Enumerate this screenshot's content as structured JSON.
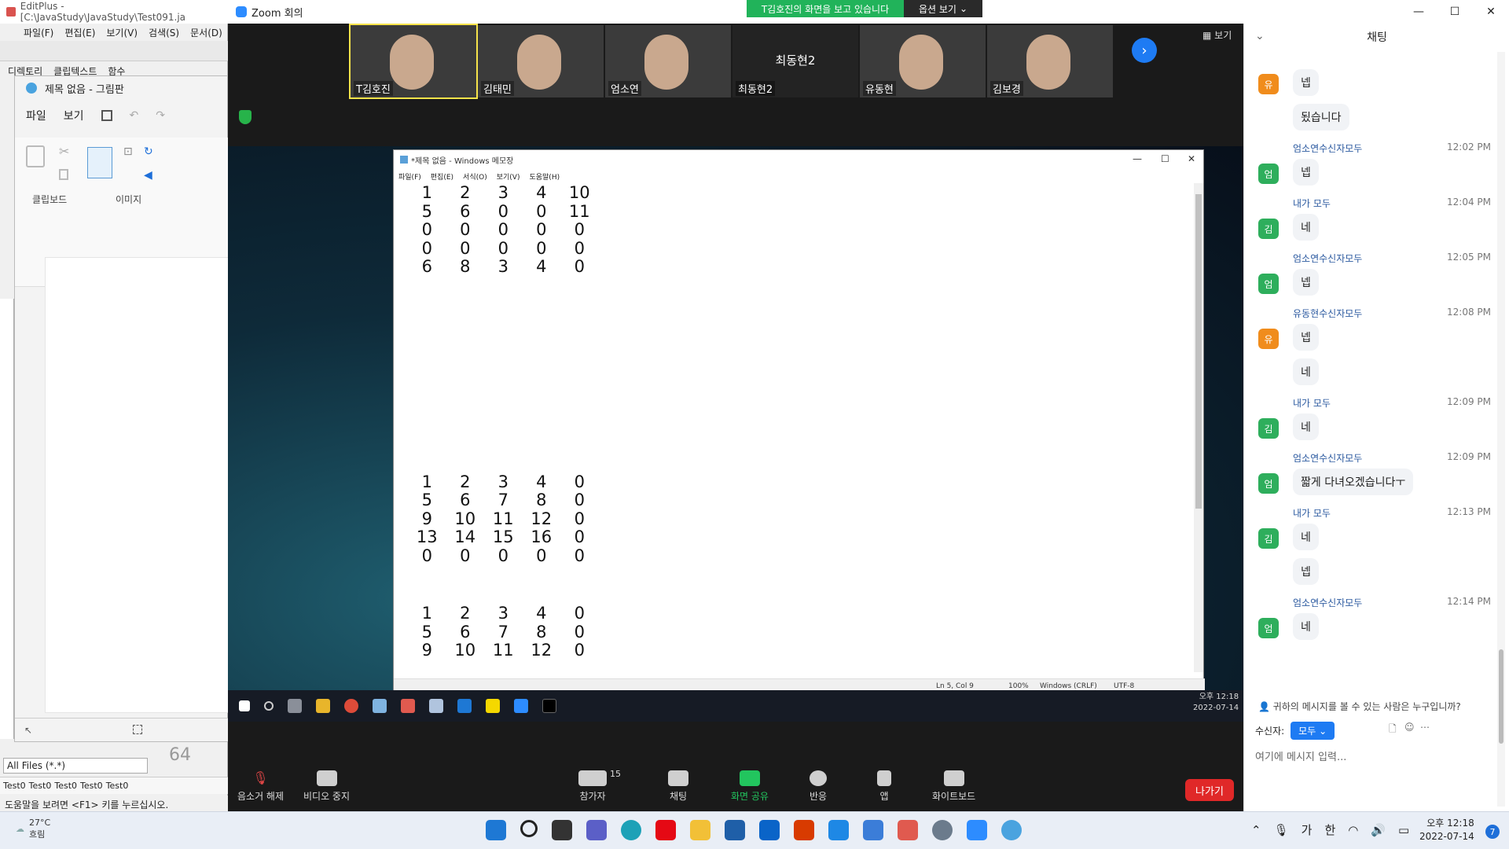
{
  "editplus": {
    "title": "EditPlus - [C:\\JavaStudy\\JavaStudy\\Test091.ja",
    "menu": [
      "파일(F)",
      "편집(E)",
      "보기(V)",
      "검색(S)",
      "문서(D)"
    ],
    "tabs": [
      "디렉토리",
      "클립텍스트",
      "함수"
    ],
    "filter": "All Files (*.*)",
    "files": [
      "Test0",
      "Test0",
      "Test0",
      "Test0",
      "Test0"
    ],
    "status": "도움말을 보려면 <F1> 키를 누르십시오.",
    "number": "64"
  },
  "paint": {
    "title": "제목 없음 - 그림판",
    "menu": [
      "파일",
      "보기"
    ],
    "groups": [
      "클립보드",
      "이미지"
    ]
  },
  "zoom": {
    "title": "Zoom 회의",
    "banner": "T김호진의 화면을 보고 있습니다",
    "view_options": "옵션 보기",
    "view_button": "보기",
    "participants": [
      {
        "name": "T김호진",
        "video": true,
        "active": true
      },
      {
        "name": "김태민",
        "video": true
      },
      {
        "name": "엄소연",
        "video": true
      },
      {
        "name": "최동현2",
        "video": false,
        "big": "최동현2"
      },
      {
        "name": "유동현",
        "video": true
      },
      {
        "name": "김보경",
        "video": true
      }
    ],
    "toolbar": {
      "mute": "음소거 해제",
      "video": "비디오 중지",
      "participants": "참가자",
      "participants_count": "15",
      "chat": "채팅",
      "share": "화면 공유",
      "reactions": "반응",
      "apps": "앱",
      "whiteboard": "화이트보드",
      "leave": "나가기"
    }
  },
  "notepad": {
    "title": "*제목 없음 - Windows 메모장",
    "menu": [
      "파일(F)",
      "편집(E)",
      "서식(O)",
      "보기(V)",
      "도움말(H)"
    ],
    "block1": [
      [
        "1",
        "2",
        "3",
        "4",
        "10"
      ],
      [
        "5",
        "6",
        "0",
        "0",
        "11"
      ],
      [
        "0",
        "0",
        "0",
        "0",
        "0"
      ],
      [
        "0",
        "0",
        "0",
        "0",
        "0"
      ],
      [
        "6",
        "8",
        "3",
        "4",
        "0"
      ]
    ],
    "block2": [
      [
        "1",
        "2",
        "3",
        "4",
        "0"
      ],
      [
        "5",
        "6",
        "7",
        "8",
        "0"
      ],
      [
        "9",
        "10",
        "11",
        "12",
        "0"
      ],
      [
        "13",
        "14",
        "15",
        "16",
        "0"
      ],
      [
        "0",
        "0",
        "0",
        "0",
        "0"
      ]
    ],
    "block3": [
      [
        "1",
        "2",
        "3",
        "4",
        "0"
      ],
      [
        "5",
        "6",
        "7",
        "8",
        "0"
      ],
      [
        "9",
        "10",
        "11",
        "12",
        "0"
      ]
    ],
    "status": {
      "position": "Ln 5, Col 9",
      "zoom": "100%",
      "eol": "Windows (CRLF)",
      "encoding": "UTF-8"
    }
  },
  "remote_clock": {
    "time": "오후 12:18",
    "date": "2022-07-14"
  },
  "chat": {
    "header": "채팅",
    "messages": [
      {
        "sender": "",
        "time": "",
        "avatar": "유",
        "color": "#f08c1c",
        "texts": [
          "넵",
          "됬습니다"
        ]
      },
      {
        "sender": "엄소연수신자모두",
        "time": "12:02 PM",
        "avatar": "엄",
        "color": "#2eae5c",
        "texts": [
          "넵"
        ]
      },
      {
        "sender": "내가 모두",
        "time": "12:04 PM",
        "avatar": "김",
        "color": "#2eae5c",
        "texts": [
          "네"
        ]
      },
      {
        "sender": "엄소연수신자모두",
        "time": "12:05 PM",
        "avatar": "엄",
        "color": "#2eae5c",
        "texts": [
          "넵"
        ]
      },
      {
        "sender": "유동현수신자모두",
        "time": "12:08 PM",
        "avatar": "유",
        "color": "#f08c1c",
        "texts": [
          "넵",
          "네"
        ]
      },
      {
        "sender": "내가 모두",
        "time": "12:09 PM",
        "avatar": "김",
        "color": "#2eae5c",
        "texts": [
          "네"
        ]
      },
      {
        "sender": "엄소연수신자모두",
        "time": "12:09 PM",
        "avatar": "엄",
        "color": "#2eae5c",
        "texts": [
          "짧게 다녀오겠습니다ㅜ"
        ]
      },
      {
        "sender": "내가 모두",
        "time": "12:13 PM",
        "avatar": "김",
        "color": "#2eae5c",
        "texts": [
          "네",
          "넵"
        ]
      },
      {
        "sender": "엄소연수신자모두",
        "time": "12:14 PM",
        "avatar": "엄",
        "color": "#2eae5c",
        "texts": [
          "네"
        ]
      }
    ],
    "who_can_see": "귀하의 메시지를 볼 수 있는 사람은 누구입니까?",
    "recipient_label": "수신자:",
    "recipient_value": "모두",
    "input_placeholder": "여기에 메시지 입력..."
  },
  "taskbar": {
    "weather_temp": "27°C",
    "weather_desc": "흐림",
    "ime1": "가",
    "ime2": "한",
    "time": "오후 12:18",
    "date": "2022-07-14",
    "notifications": "7"
  }
}
